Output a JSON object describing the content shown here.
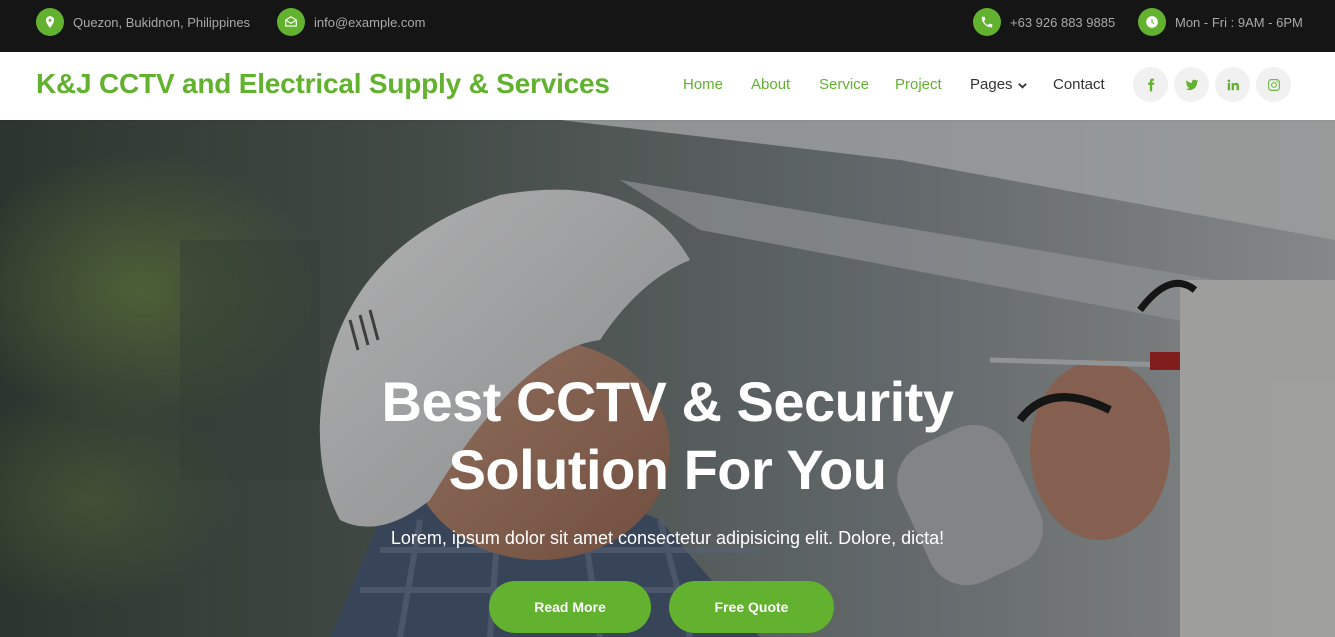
{
  "topbar": {
    "address": "Quezon, Bukidnon, Philippines",
    "email": "info@example.com",
    "phone": "+63 926 883 9885",
    "hours": "Mon - Fri : 9AM - 6PM"
  },
  "navbar": {
    "brand": "K&J CCTV and Electrical Supply & Services",
    "links": [
      {
        "label": "Home"
      },
      {
        "label": "About"
      },
      {
        "label": "Service"
      },
      {
        "label": "Project"
      },
      {
        "label": "Pages"
      },
      {
        "label": "Contact"
      }
    ],
    "social": [
      "facebook-icon",
      "twitter-icon",
      "linkedin-icon",
      "instagram-icon"
    ]
  },
  "hero": {
    "title_line1": "Best CCTV & Security",
    "title_line2": "Solution For You",
    "subtitle": "Lorem, ipsum dolor sit amet consectetur adipisicing elit. Dolore, dicta!",
    "buttons": [
      {
        "label": "Read More"
      },
      {
        "label": "Free Quote"
      }
    ]
  },
  "colors": {
    "accent": "#62b12f",
    "topbar_bg": "#151515",
    "nav_dark_text": "#333333"
  }
}
